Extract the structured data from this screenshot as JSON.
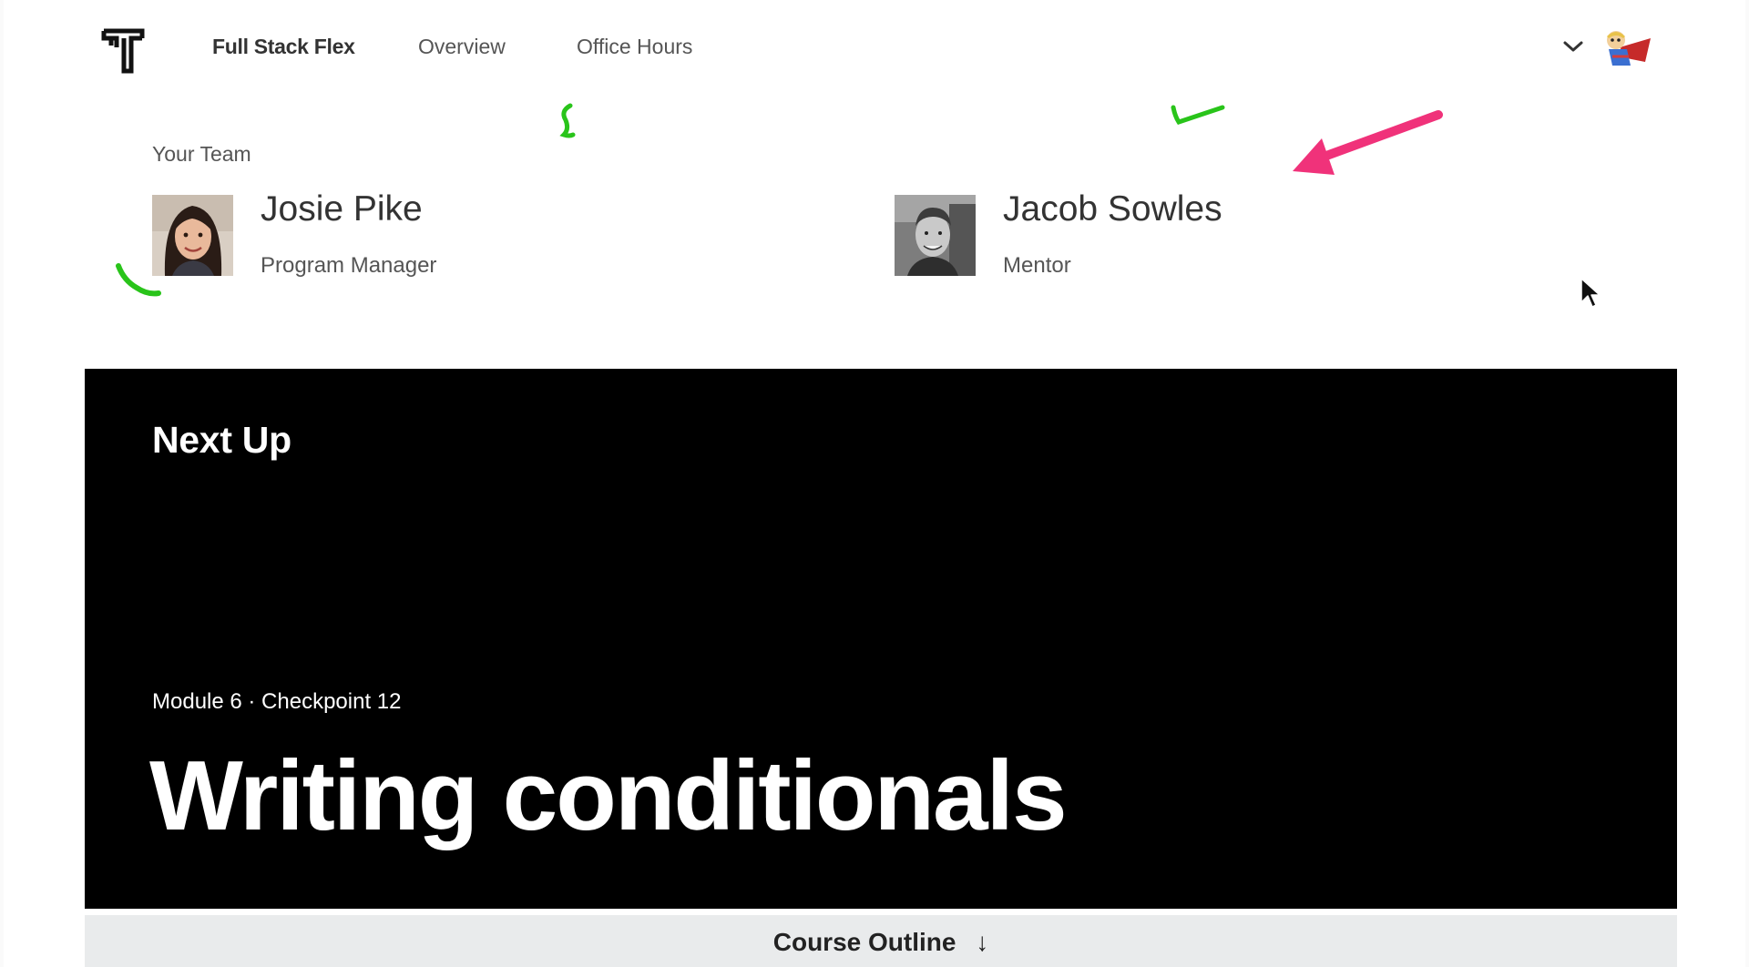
{
  "nav": {
    "brand": "Full Stack Flex",
    "links": [
      "Overview",
      "Office Hours"
    ],
    "icons": {
      "logo": "thinkful-t-logo",
      "chevron": "chevron-down-icon",
      "avatar": "superhero-avatar"
    }
  },
  "team": {
    "label": "Your Team",
    "members": [
      {
        "name": "Josie Pike",
        "role": "Program Manager"
      },
      {
        "name": "Jacob Sowles",
        "role": "Mentor"
      }
    ]
  },
  "next_up": {
    "heading": "Next Up",
    "meta": "Module 6 · Checkpoint 12",
    "title": "Writing conditionals"
  },
  "outline": {
    "label": "Course Outline",
    "arrow": "↓"
  },
  "colors": {
    "panel_bg": "#000000",
    "outline_bg": "#e9ebec",
    "annotation_pink": "#f0327a",
    "annotation_green": "#29c41a"
  }
}
